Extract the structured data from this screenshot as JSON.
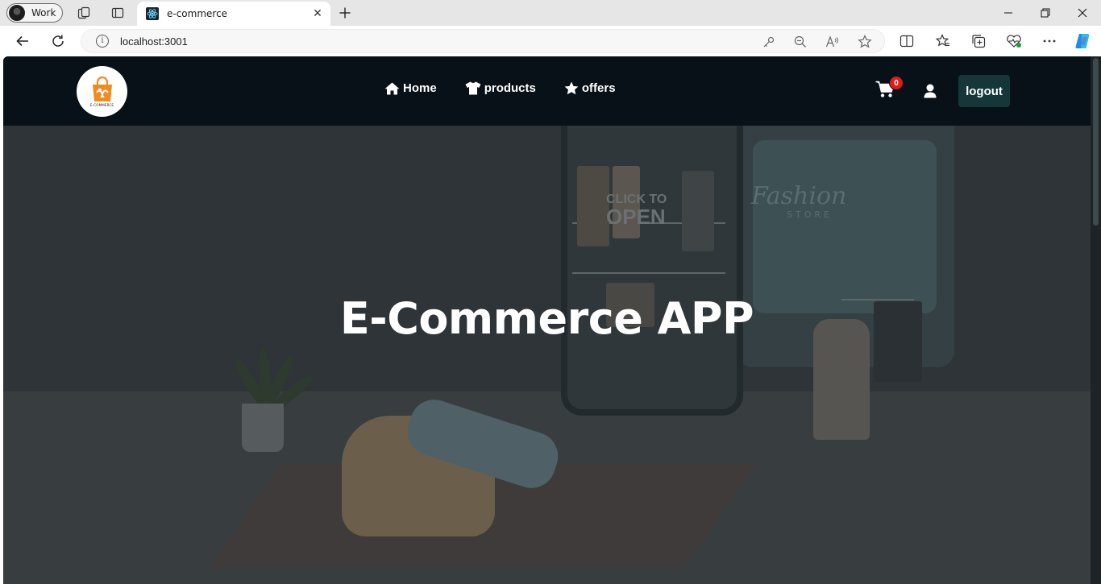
{
  "browser": {
    "profile_name": "Work",
    "tab_title": "e-commerce",
    "url": "localhost:3001"
  },
  "navbar": {
    "logo_text": "E-COMMERCE",
    "menu": [
      {
        "label": "Home",
        "icon": "home-icon"
      },
      {
        "label": "products",
        "icon": "shirt-icon"
      },
      {
        "label": "offers",
        "icon": "star-icon"
      }
    ],
    "cart_count": "0",
    "logout_label": "logout"
  },
  "hero": {
    "title": "E-Commerce APP",
    "background_sign_main": "Fashion",
    "background_sign_sub": "STORE",
    "background_click_line1": "CLICK TO",
    "background_click_line2": "OPEN"
  },
  "colors": {
    "navbar_bg": "#071117",
    "logout_bg": "#15373a",
    "badge": "#e01b1b",
    "logo_orange": "#f08c1e"
  }
}
